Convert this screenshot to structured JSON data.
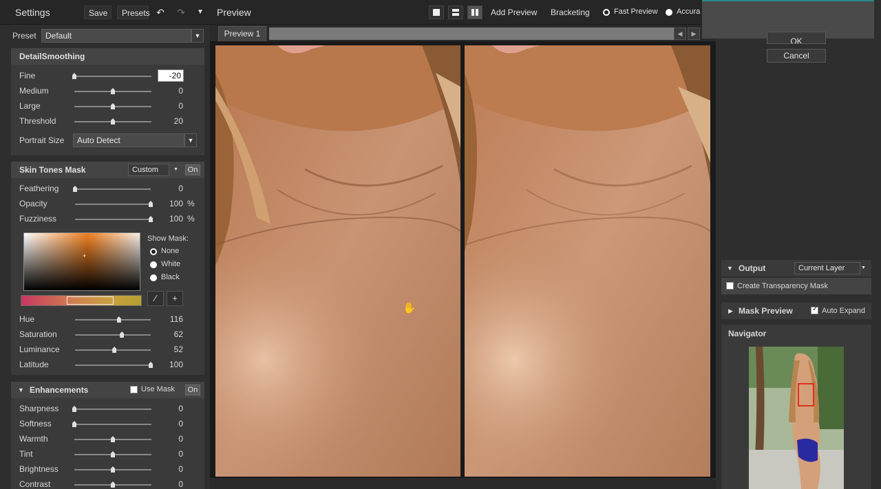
{
  "settings": {
    "title": "Settings",
    "save_label": "Save",
    "presets_label": "Presets",
    "preset_label": "Preset",
    "preset_value": "Default"
  },
  "detail_smoothing": {
    "title": "DetailSmoothing",
    "sliders": [
      {
        "label": "Fine",
        "value": "-20",
        "level": 0.0
      },
      {
        "label": "Medium",
        "value": "0",
        "level": 0.5
      },
      {
        "label": "Large",
        "value": "0",
        "level": 0.5
      },
      {
        "label": "Threshold",
        "value": "20",
        "level": 0.5
      }
    ],
    "portrait_size_label": "Portrait Size",
    "portrait_size_value": "Auto Detect"
  },
  "skin_tones": {
    "title": "Skin Tones Mask",
    "mode": "Custom",
    "on_label": "On",
    "sliders": [
      {
        "label": "Feathering",
        "value": "0",
        "unit": "",
        "level": 0.0
      },
      {
        "label": "Opacity",
        "value": "100",
        "unit": "%",
        "level": 1.0
      },
      {
        "label": "Fuzziness",
        "value": "100",
        "unit": "%",
        "level": 1.0
      }
    ],
    "show_mask_label": "Show Mask:",
    "show_mask_options": [
      "None",
      "White",
      "Black"
    ],
    "show_mask_selected": "None",
    "hsl_sliders": [
      {
        "label": "Hue",
        "value": "116",
        "level": 0.58
      },
      {
        "label": "Saturation",
        "value": "62",
        "level": 0.62
      },
      {
        "label": "Luminance",
        "value": "52",
        "level": 0.52
      },
      {
        "label": "Latitude",
        "value": "100",
        "level": 1.0
      }
    ]
  },
  "enhancements": {
    "title": "Enhancements",
    "use_mask_label": "Use Mask",
    "on_label": "On",
    "sliders": [
      {
        "label": "Sharpness",
        "value": "0",
        "level": 0.0
      },
      {
        "label": "Softness",
        "value": "0",
        "level": 0.0
      },
      {
        "label": "Warmth",
        "value": "0",
        "level": 0.5
      },
      {
        "label": "Tint",
        "value": "0",
        "level": 0.5
      },
      {
        "label": "Brightness",
        "value": "0",
        "level": 0.5
      },
      {
        "label": "Contrast",
        "value": "0",
        "level": 0.5
      }
    ]
  },
  "preview": {
    "title": "Preview",
    "add_preview_label": "Add Preview",
    "bracketing_label": "Bracketing",
    "fast_preview_label": "Fast Preview",
    "accurate_label": "Accura",
    "tab_label": "Preview 1"
  },
  "right": {
    "ok_label": "OK",
    "cancel_label": "Cancel",
    "output_label": "Output",
    "output_value": "Current Layer",
    "create_mask_label": "Create Transparency Mask",
    "mask_preview_label": "Mask Preview",
    "auto_expand_label": "Auto Expand",
    "navigator_label": "Navigator"
  },
  "colors": {
    "panel_bg": "#2e2e2e",
    "section_bg": "#3a3a3a",
    "skin": "#c08a64",
    "accent_red": "#e03020"
  }
}
